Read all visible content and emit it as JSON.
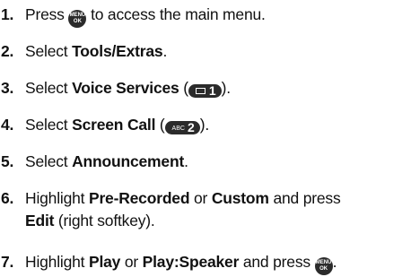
{
  "steps": [
    {
      "num": "1.",
      "before": "Press ",
      "after": " to access the main menu."
    },
    {
      "num": "2.",
      "before": "Select ",
      "bold": "Tools/Extras",
      "after": "."
    },
    {
      "num": "3.",
      "before": "Select ",
      "bold": "Voice Services",
      "open": " (",
      "key_digit": "1",
      "close": ")."
    },
    {
      "num": "4.",
      "before": "Select ",
      "bold": "Screen Call",
      "open": " (",
      "key_letters": "ABC",
      "key_digit": "2",
      "close": ")."
    },
    {
      "num": "5.",
      "before": "Select ",
      "bold": "Announcement",
      "after": "."
    },
    {
      "num": "6.",
      "before": "Highlight ",
      "bold": "Pre-Recorded",
      "mid": " or ",
      "bold2": "Custom",
      "after": " and press",
      "line2_bold": "Edit",
      "line2_after": " (right softkey)."
    },
    {
      "num": "7.",
      "before": "Highlight ",
      "bold": "Play",
      "mid": " or ",
      "bold2": "Play:Speaker",
      "after": " and press ",
      "end": "."
    }
  ],
  "menu_key": {
    "top": "MENU",
    "bottom": "OK"
  }
}
